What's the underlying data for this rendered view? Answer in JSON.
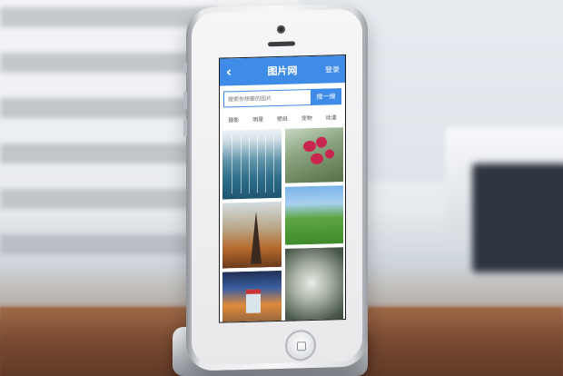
{
  "app": {
    "title": "图片网",
    "login_label": "登录",
    "back_icon": "chevron-left-icon"
  },
  "search": {
    "placeholder": "搜索你想要的图片",
    "button_label": "搜一搜"
  },
  "categories": [
    {
      "label": "摄影"
    },
    {
      "label": "明星"
    },
    {
      "label": "壁纸"
    },
    {
      "label": "宠物"
    },
    {
      "label": "动漫"
    }
  ],
  "gallery": {
    "tiles": [
      {
        "subject": "blue-waterfall"
      },
      {
        "subject": "pink-orchids"
      },
      {
        "subject": "eiffel-tower-sunset"
      },
      {
        "subject": "green-meadow"
      },
      {
        "subject": "beach-lifeguard-hut"
      },
      {
        "subject": "grey-abstract"
      }
    ]
  },
  "colors": {
    "accent": "#3f8be8",
    "topbar_text": "#ffffff",
    "category_text": "#555555"
  }
}
